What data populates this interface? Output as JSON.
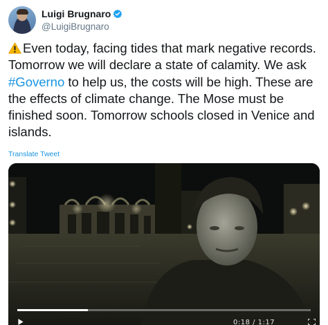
{
  "user": {
    "display_name": "Luigi Brugnaro",
    "handle": "@LuigiBrugnaro",
    "verified": true
  },
  "tweet": {
    "warning_icon": "warning-icon",
    "text_before_hashtag": "Even today, facing tides that mark negative records. Tomorrow we will declare a state of calamity. We ask ",
    "hashtag": "#Governo",
    "text_after_hashtag": " to help us, the costs will be high. These are the effects of climate change. The Mose must be finished soon. Tomorrow schools closed in Venice and islands.",
    "translate_label": "Translate Tweet"
  },
  "video": {
    "progress": 0.24,
    "time_display": "0:18 / 1:17",
    "play_icon": "play-icon",
    "fullscreen_icon": "fullscreen-icon"
  },
  "colors": {
    "link": "#1b95e0",
    "secondary_text": "#657786",
    "verified_badge": "#1da1f2"
  }
}
